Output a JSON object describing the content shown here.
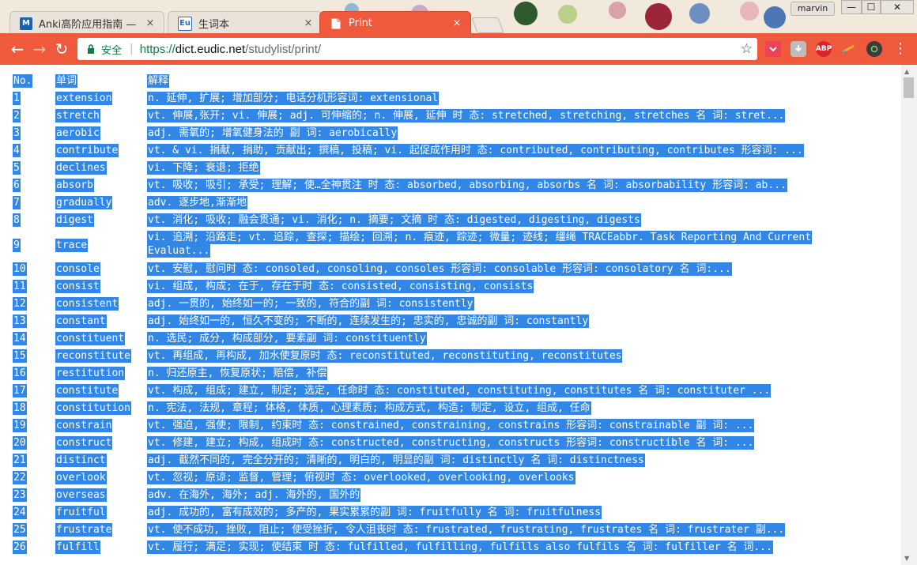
{
  "browser": {
    "tabs": [
      {
        "title": "Anki高阶应用指南 — Co",
        "favicon": "M",
        "favicon_color": "#1a5fb4",
        "active": false
      },
      {
        "title": "生词本",
        "favicon": "Eu",
        "favicon_color": "#2d6cc0",
        "active": false
      },
      {
        "title": "Print",
        "favicon": "doc",
        "active": true
      }
    ],
    "close_symbol": "×",
    "profile_name": "marvin",
    "window_controls": {
      "minimize": "—",
      "maximize": "☐",
      "close": "✕"
    },
    "back": "←",
    "forward": "→",
    "reload": "↻",
    "security_label": "安全",
    "url_protocol": "https://",
    "url_host": "dict.eudic.net",
    "url_path": "/studylist/print/",
    "star": "☆",
    "extensions": [
      {
        "name": "pocket-icon",
        "color": "#ee4056",
        "label": ""
      },
      {
        "name": "download-icon",
        "color": "#bdbdbd",
        "label": ""
      },
      {
        "name": "adblock-plus-icon",
        "color": "#d7262e",
        "label": "ABP"
      },
      {
        "name": "pencil-icon",
        "color": "#f0b429",
        "label": ""
      },
      {
        "name": "camera-icon",
        "color": "#3c3c3c",
        "label": ""
      }
    ],
    "menu": "⋮",
    "accent_color": "#ef5a3c"
  },
  "table": {
    "headers": {
      "no": "No.",
      "word": "单词",
      "definition": "解释"
    },
    "rows": [
      {
        "no": "1",
        "word": "extension",
        "definition": "n. 延伸, 扩展; 增加部分; 电话分机形容词: extensional"
      },
      {
        "no": "2",
        "word": "stretch",
        "definition": "vt. 伸展,张开; vi. 伸展; adj. 可伸缩的; n. 伸展, 延伸 时 态: stretched, stretching, stretches 名 词: stret..."
      },
      {
        "no": "3",
        "word": "aerobic",
        "definition": "adj. 需氧的; 增氧健身法的 副 词: aerobically"
      },
      {
        "no": "4",
        "word": "contribute",
        "definition": "vt. & vi. 捐献, 捐助, 贡献出; 撰稿, 投稿; vi. 起促成作用时 态: contributed, contributing, contributes 形容词: ..."
      },
      {
        "no": "5",
        "word": "declines",
        "definition": "vi. 下降; 衰退; 拒绝"
      },
      {
        "no": "6",
        "word": "absorb",
        "definition": "vt. 吸收; 吸引; 承受; 理解; 使…全神贯注 时 态: absorbed, absorbing, absorbs 名 词: absorbability 形容词: ab..."
      },
      {
        "no": "7",
        "word": "gradually",
        "definition": "adv. 逐步地,渐渐地"
      },
      {
        "no": "8",
        "word": "digest",
        "definition": "vt. 消化; 吸收; 融会贯通; vi. 消化; n. 摘要; 文摘 时 态: digested, digesting, digests"
      },
      {
        "no": "9",
        "word": "trace",
        "definition": "vi. 追溯; 沿路走; vt. 追踪, 查探; 描绘; 回溯; n. 痕迹, 踪迹; 微量; 迹线; 缰绳 TRACEabbr. Task Reporting And Current",
        "definition_line2": "Evaluat...",
        "tall": true
      },
      {
        "no": "10",
        "word": "console",
        "definition": "vt. 安慰, 慰问时 态: consoled, consoling, consoles 形容词: consolable 形容词: consolatory 名 词:..."
      },
      {
        "no": "11",
        "word": "consist",
        "definition": "vi. 组成, 构成; 在于, 存在于时 态: consisted, consisting, consists"
      },
      {
        "no": "12",
        "word": "consistent",
        "definition": "adj. 一贯的, 始终如一的; 一致的, 符合的副 词: consistently"
      },
      {
        "no": "13",
        "word": "constant",
        "definition": "adj. 始终如一的, 恒久不变的; 不断的, 连续发生的; 忠实的, 忠诚的副 词: constantly"
      },
      {
        "no": "14",
        "word": "constituent",
        "definition": "n. 选民; 成分, 构成部分, 要素副 词: constituently"
      },
      {
        "no": "15",
        "word": "reconstitute",
        "definition": "vt. 再组成, 再构成, 加水使复原时 态: reconstituted, reconstituting, reconstitutes"
      },
      {
        "no": "16",
        "word": "restitution",
        "definition": "n. 归还原主, 恢复原状; 赔偿, 补偿"
      },
      {
        "no": "17",
        "word": "constitute",
        "definition": "vt. 构成, 组成; 建立, 制定; 选定, 任命时 态: constituted, constituting, constitutes 名 词: constituter ..."
      },
      {
        "no": "18",
        "word": "constitution",
        "definition": "n. 宪法, 法规, 章程; 体格, 体质, 心理素质; 构成方式, 构造; 制定, 设立, 组成, 任命"
      },
      {
        "no": "19",
        "word": "constrain",
        "definition": "vt. 强迫, 强使; 限制, 约束时 态: constrained, constraining, constrains 形容词: constrainable 副 词: ..."
      },
      {
        "no": "20",
        "word": "construct",
        "definition": "vt. 修建, 建立; 构成, 组成时 态: constructed, constructing, constructs 形容词: constructible 名 词: ..."
      },
      {
        "no": "21",
        "word": "distinct",
        "definition": "adj. 截然不同的, 完全分开的; 清晰的, 明白的, 明显的副 词: distinctly 名 词: distinctness"
      },
      {
        "no": "22",
        "word": "overlook",
        "definition": "vt. 忽视; 原谅; 监督, 管理; 俯视时 态: overlooked, overlooking, overlooks"
      },
      {
        "no": "23",
        "word": "overseas",
        "definition": "adv. 在海外, 海外; adj. 海外的, 国外的"
      },
      {
        "no": "24",
        "word": "fruitful",
        "definition": "adj. 成功的, 富有成效的; 多产的, 果实累累的副 词: fruitfully 名 词: fruitfulness"
      },
      {
        "no": "25",
        "word": "frustrate",
        "definition": "vt. 使不成功, 挫败, 阻止; 使受挫折, 令人沮丧时 态: frustrated, frustrating, frustrates 名 词: frustrater 副..."
      },
      {
        "no": "26",
        "word": "fulfill",
        "definition": "vt. 履行; 满足; 实现; 使结束 时 态: fulfilled, fulfilling, fulfills also fulfils 名 词: fulfiller 名 词..."
      }
    ]
  }
}
